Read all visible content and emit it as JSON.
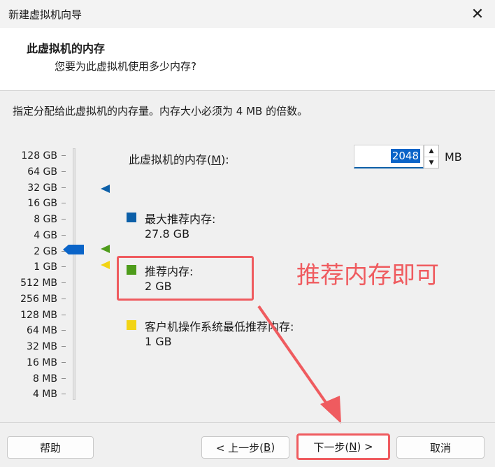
{
  "window": {
    "title": "新建虚拟机向导",
    "close_glyph": "✕"
  },
  "header": {
    "title": "此虚拟机的内存",
    "subtitle": "您要为此虚拟机使用多少内存?"
  },
  "instruction": "指定分配给此虚拟机的内存量。内存大小必须为 4 MB 的倍数。",
  "memory": {
    "label_prefix": "此虚拟机的内存(",
    "label_key": "M",
    "label_suffix": "):",
    "value": "2048",
    "unit": "MB"
  },
  "scale": [
    "128 GB",
    "64 GB",
    "32 GB",
    "16 GB",
    "8 GB",
    "4 GB",
    "2 GB",
    "1 GB",
    "512 MB",
    "256 MB",
    "128 MB",
    "64 MB",
    "32 MB",
    "16 MB",
    "8 MB",
    "4 MB"
  ],
  "legend": [
    {
      "label": "最大推荐内存:",
      "value": "27.8 GB",
      "color": "#0c5fa8"
    },
    {
      "label": "推荐内存:",
      "value": "2 GB",
      "color": "#4e9c1b"
    },
    {
      "label": "客户机操作系统最低推荐内存:",
      "value": "1 GB",
      "color": "#f2d414"
    }
  ],
  "annotation": {
    "text": "推荐内存即可",
    "color": "#ef5b5f"
  },
  "buttons": {
    "help": "帮助",
    "back_prefix": "< 上一步(",
    "back_key": "B",
    "back_suffix": ")",
    "next_prefix": "下一步(",
    "next_key": "N",
    "next_suffix": ") >",
    "cancel": "取消"
  },
  "colors": {
    "accent": "#0a64c8",
    "annotation": "#ef5b5f"
  }
}
